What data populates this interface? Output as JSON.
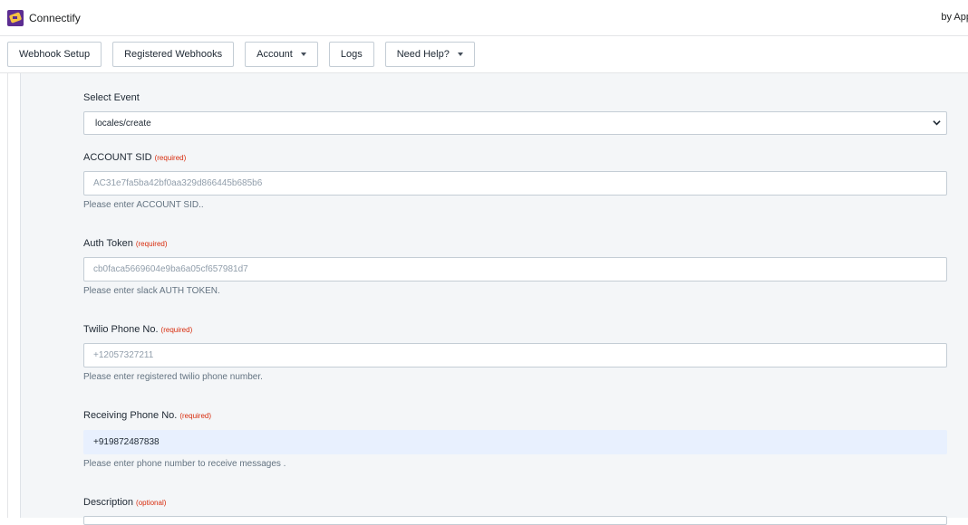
{
  "app": {
    "title": "Connectify",
    "by_text": "by App"
  },
  "nav": {
    "webhook_setup": "Webhook Setup",
    "registered_webhooks": "Registered Webhooks",
    "account": "Account",
    "logs": "Logs",
    "need_help": "Need Help?"
  },
  "form": {
    "select_event": {
      "label": "Select Event",
      "value": "locales/create"
    },
    "account_sid": {
      "label": "ACCOUNT SID",
      "badge": "(required)",
      "placeholder": "AC31e7fa5ba42bf0aa329d866445b685b6",
      "help": "Please enter ACCOUNT SID.."
    },
    "auth_token": {
      "label": "Auth Token",
      "badge": "(required)",
      "placeholder": "cb0faca5669604e9ba6a05cf657981d7",
      "help": "Please enter slack AUTH TOKEN."
    },
    "twilio_phone": {
      "label": "Twilio Phone No.",
      "badge": "(required)",
      "placeholder": "+12057327211",
      "help": "Please enter registered twilio phone number."
    },
    "receiving_phone": {
      "label": "Receiving Phone No.",
      "badge": "(required)",
      "value": "+919872487838",
      "help": "Please enter phone number to receive messages ."
    },
    "description": {
      "label": "Description",
      "badge": "(optional)"
    }
  }
}
